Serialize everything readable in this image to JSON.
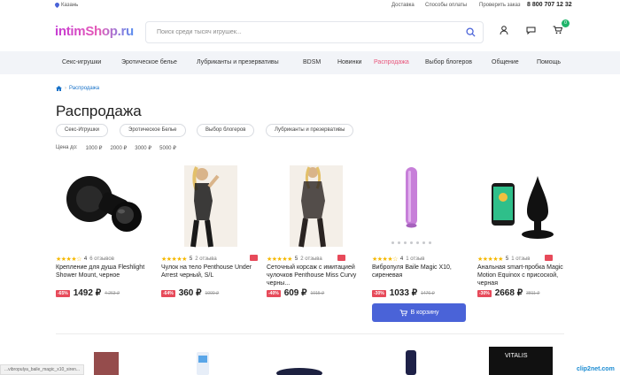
{
  "topbar": {
    "city": "Казань",
    "links": [
      "Доставка",
      "Способы оплаты",
      "Проверить заказ"
    ],
    "phone": "8 800 707 12 32"
  },
  "logo": {
    "text": "intimShop.ru"
  },
  "search": {
    "placeholder": "Поиск среди тысяч игрушек..."
  },
  "cart": {
    "count": "0"
  },
  "nav": {
    "items": [
      "Секс-игрушки",
      "Эротическое белье",
      "Лубриканты и презервативы",
      "BDSM",
      "Новинки",
      "Распродажа",
      "Выбор блогеров",
      "Общение",
      "Помощь"
    ],
    "active": "Распродажа"
  },
  "breadcrumb": {
    "current": "Распродажа"
  },
  "page": {
    "title": "Распродажа"
  },
  "filters": {
    "chips": [
      "Секс-Игрушки",
      "Эротическое Белье",
      "Выбор блогеров",
      "Лубриканты и презервативы"
    ],
    "price_label": "Цена до:",
    "price_options": [
      "1000 ₽",
      "2000 ₽",
      "3000 ₽",
      "5000 ₽"
    ]
  },
  "products": [
    {
      "rating": "4",
      "reviews": "6 отзывов",
      "name": "Крепление для душа Fleshlight Shower Mount, черное",
      "discount": "-65%",
      "price": "1492 ₽",
      "old_price": "4 263 ₽"
    },
    {
      "rating": "5",
      "reviews": "2 отзыва",
      "name": "Чулок на тело Penthouse Under Arrest черный, S/L",
      "discount": "-64%",
      "price": "360 ₽",
      "old_price": "1000 ₽"
    },
    {
      "rating": "5",
      "reviews": "2 отзыва",
      "name": "Сеточный корсаж с имитацией чулочков Penthouse Miss Curvy черны...",
      "discount": "-40%",
      "price": "609 ₽",
      "old_price": "1015 ₽"
    },
    {
      "rating": "4",
      "reviews": "1 отзыв",
      "name": "Вибропуля Baile Magic X10, сиреневая",
      "discount": "-30%",
      "price": "1033 ₽",
      "old_price": "1476 ₽"
    },
    {
      "rating": "5",
      "reviews": "1 отзыв",
      "name": "Анальная smart-пробка Magic Motion Equinox с присоской, черная",
      "discount": "-30%",
      "price": "2668 ₽",
      "old_price": "3811 ₽"
    }
  ],
  "buy_button": {
    "label": "В корзину"
  },
  "status_bar": {
    "url": "...vibropulya_baile_magic_x10_siren..."
  },
  "watermark": {
    "text": "clip2net.com"
  },
  "colors": {
    "accent": "#4a63d8",
    "sale": "#e74a5a",
    "nav_active": "#e8567c",
    "cart_badge": "#1fb46a"
  }
}
